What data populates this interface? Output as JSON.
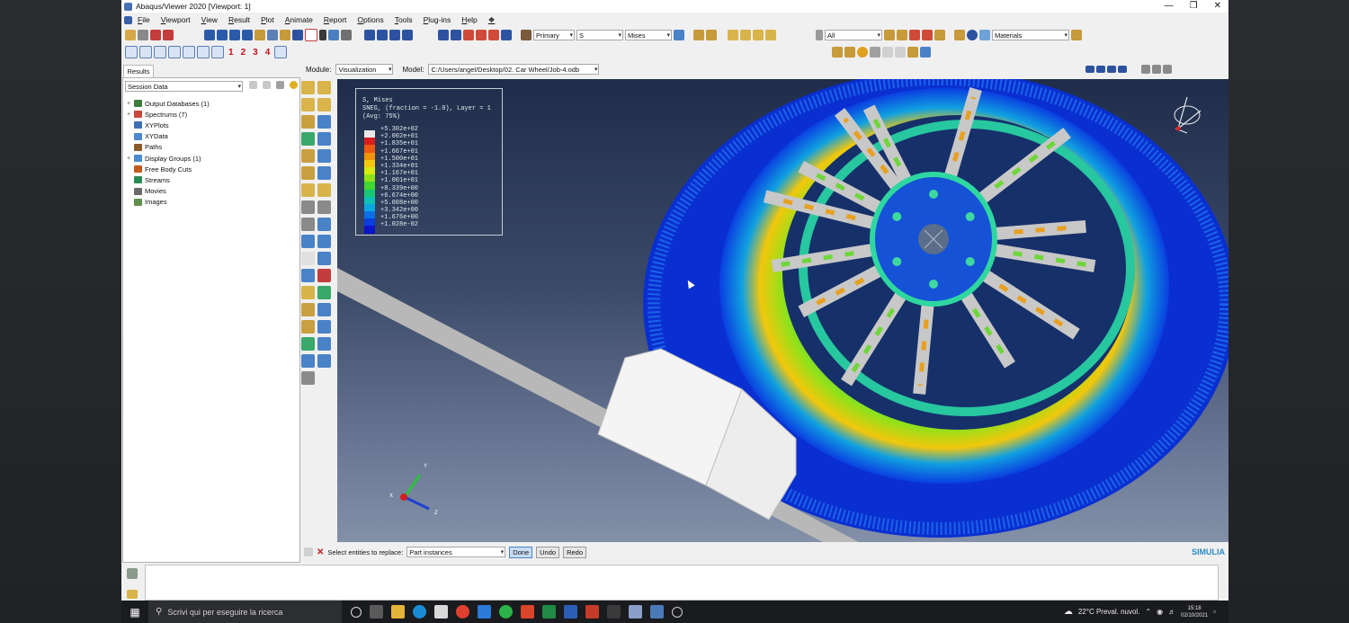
{
  "window": {
    "title": "Abaqus/Viewer 2020 [Viewport: 1]"
  },
  "menu": [
    "File",
    "Viewport",
    "View",
    "Result",
    "Plot",
    "Animate",
    "Report",
    "Options",
    "Tools",
    "Plug-ins",
    "Help",
    "❖"
  ],
  "toolbar": {
    "step_primary": "Primary",
    "step_value": "S",
    "field_output": "Mises",
    "filter_all": "All",
    "color_code": "Materials",
    "numbers": [
      "1",
      "2",
      "3",
      "4"
    ]
  },
  "context": {
    "results_tab": "Results",
    "module_label": "Module:",
    "module_value": "Visualization",
    "model_label": "Model:",
    "model_path": "C:/Users/angel/Desktop/02. Car Wheel/Job-4.odb"
  },
  "tree": {
    "session_select": "Session Data",
    "items": [
      {
        "label": "Output Databases (1)",
        "expand": "+",
        "color": "#3f7c3a"
      },
      {
        "label": "Spectrums (7)",
        "expand": "+",
        "color": "#c9483b"
      },
      {
        "label": "XYPlots",
        "expand": "",
        "color": "#3e6fb9"
      },
      {
        "label": "XYData",
        "expand": "",
        "color": "#4d88d0"
      },
      {
        "label": "Paths",
        "expand": "",
        "color": "#8a5a2a"
      },
      {
        "label": "Display Groups (1)",
        "expand": "+",
        "color": "#4a8bd1"
      },
      {
        "label": "Free Body Cuts",
        "expand": "",
        "color": "#c35a1d"
      },
      {
        "label": "Streams",
        "expand": "",
        "color": "#2a8a55"
      },
      {
        "label": "Movies",
        "expand": "",
        "color": "#6a6a6a"
      },
      {
        "label": "Images",
        "expand": "",
        "color": "#5f8f4e"
      }
    ]
  },
  "legend": {
    "title": "S, Mises",
    "subtitle": "SNEG, (fraction = -1.0), Layer = 1",
    "avg": "(Avg: 75%)",
    "values": [
      "+5.302e+02",
      "+2.002e+01",
      "+1.835e+01",
      "+1.667e+01",
      "+1.500e+01",
      "+1.334e+01",
      "+1.167e+01",
      "+1.001e+01",
      "+8.339e+00",
      "+6.674e+00",
      "+5.008e+00",
      "+3.342e+00",
      "+1.676e+00",
      "+1.028e-02"
    ],
    "colors": [
      "#e8e8e8",
      "#d81e1e",
      "#ee5a12",
      "#f2930c",
      "#f5c70c",
      "#d6ea10",
      "#8fe21a",
      "#3fd730",
      "#16c874",
      "#0cc2b4",
      "#0aa6e0",
      "#0a6fe6",
      "#0a3ee0",
      "#0a14c8"
    ]
  },
  "triad": {
    "y": "Y",
    "x": "X",
    "z": "Z"
  },
  "prompt": {
    "text": "Select entities to replace:",
    "select_value": "Part instances",
    "done": "Done",
    "undo": "Undo",
    "redo": "Redo"
  },
  "brand": "SIMULIA",
  "taskbar": {
    "search_placeholder": "Scrivi qui per eseguire la ricerca",
    "weather": "22°C  Preval. nuvol.",
    "time": "15:18",
    "date": "02/10/2021"
  }
}
